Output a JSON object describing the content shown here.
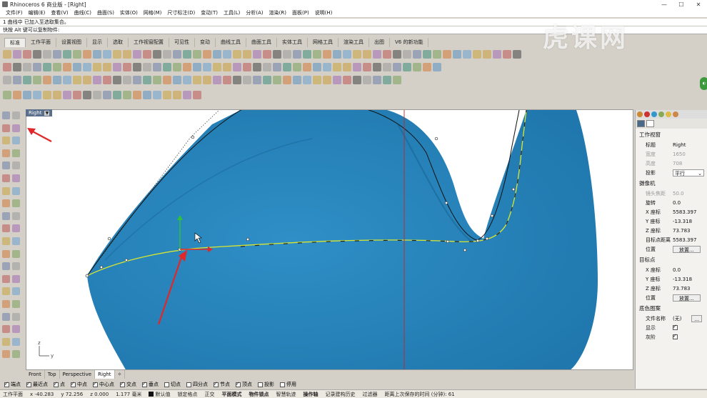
{
  "title": "Rhinoceros 6 商业版 - [Right]",
  "menu": [
    "文件(F)",
    "编辑(E)",
    "查看(V)",
    "曲线(C)",
    "曲面(S)",
    "实体(O)",
    "网格(M)",
    "尺寸标注(D)",
    "变动(T)",
    "工具(L)",
    "分析(A)",
    "渲染(R)",
    "面板(P)",
    "说明(H)"
  ],
  "command_history": "1 曲线中 已加入至选取集合。",
  "command_prompt": "快按 Alt 键可以复制物件:",
  "toolbar_tabs": [
    "标准",
    "工作平面",
    "设置视图",
    "显示",
    "选取",
    "工作视窗配置",
    "可见性",
    "变动",
    "曲线工具",
    "曲面工具",
    "实体工具",
    "网格工具",
    "渲染工具",
    "出图",
    "V6 的新功能"
  ],
  "active_toolbar_tab": "标准",
  "viewport": {
    "name": "Right",
    "axis_z": "z",
    "axis_y": "y"
  },
  "viewport_tabs": [
    "Front",
    "Top",
    "Perspective",
    "Right"
  ],
  "active_viewport_tab": "Right",
  "osnaps": [
    {
      "label": "端点",
      "on": true
    },
    {
      "label": "最近点",
      "on": true
    },
    {
      "label": "点",
      "on": true
    },
    {
      "label": "中点",
      "on": true
    },
    {
      "label": "中心点",
      "on": true
    },
    {
      "label": "交点",
      "on": true
    },
    {
      "label": "垂点",
      "on": true
    },
    {
      "label": "切点",
      "on": false
    },
    {
      "label": "四分点",
      "on": false
    },
    {
      "label": "节点",
      "on": true
    },
    {
      "label": "顶点",
      "on": true
    },
    {
      "label": "投影",
      "on": false
    },
    {
      "label": "停用",
      "on": false
    }
  ],
  "status": {
    "plane": "工作平面",
    "x": "x -40.283",
    "y": "y 72.256",
    "z": "z 0.000",
    "units": "1.177 毫米",
    "layer": "默认值",
    "lock_grid": "锁定格点",
    "ortho": "正交",
    "planar": "平面模式",
    "osnap": "物件锁点",
    "smarttrack": "智慧轨迹",
    "gumball": "操作轴",
    "history": "记录建构历史",
    "filter": "过滤器",
    "autosave": "距离上次保存的时间 (分钟): 61"
  },
  "panel": {
    "viewport_section": "工作视窗",
    "title_label": "标题",
    "title_value": "Right",
    "width_label": "宽度",
    "width_value": "1650",
    "height_label": "高度",
    "height_value": "708",
    "projection_label": "投影",
    "projection_value": "平行",
    "camera_section": "摄像机",
    "lens_label": "镜头焦距",
    "lens_value": "50.0",
    "rotation_label": "旋转",
    "rotation_value": "0.0",
    "cam_x_label": "X 座标",
    "cam_x_value": "5583.397",
    "cam_y_label": "Y 座标",
    "cam_y_value": "-13.318",
    "cam_z_label": "Z 座标",
    "cam_z_value": "73.783",
    "target_dist_label": "目标点距离",
    "target_dist_value": "5583.397",
    "position_label": "位置",
    "place_button": "放置...",
    "target_section": "目标点",
    "tgt_x_label": "X 座标",
    "tgt_x_value": "0.0",
    "tgt_y_label": "Y 座标",
    "tgt_y_value": "-13.318",
    "tgt_z_label": "Z 座标",
    "tgt_z_value": "73.783",
    "tgt_position_label": "位置",
    "tgt_place_button": "放置...",
    "wallpaper_section": "底色图案",
    "filename_label": "文件名称",
    "filename_value": "(无)",
    "show_label": "显示",
    "gray_label": "灰阶"
  },
  "watermark": "虎课网",
  "colors": {
    "chrome": "#d4d0c8",
    "viewport_label_bg": "#5a6f8c",
    "chair_blue": "#2f8fc6",
    "curve_yellow": "#e8f040",
    "arrow_red": "#e0282a"
  }
}
